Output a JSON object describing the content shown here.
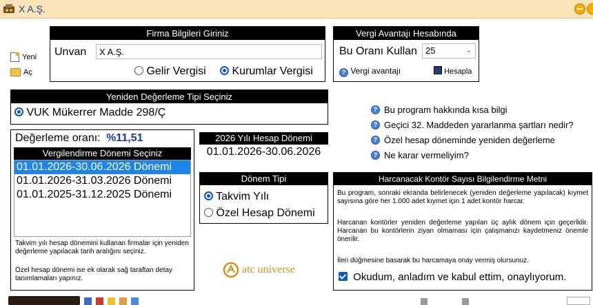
{
  "window": {
    "title": "X A.Ş."
  },
  "side": {
    "new_label": "Yeni",
    "open_label": "Aç"
  },
  "firma": {
    "header": "Firma Bilgileri Giriniz",
    "unvan_label": "Unvan",
    "unvan_value": "X A.Ş.",
    "radio_gelir": "Gelir Vergisi",
    "radio_kurumlar": "Kurumlar Vergisi",
    "selected": "kurumlar"
  },
  "vergi": {
    "header": "Vergi Avantajı Hesabında",
    "oran_label": "Bu Oranı Kullan",
    "oran_value": "25",
    "avantaj_label": "Vergi avantajı",
    "hesapla_label": "Hesapla"
  },
  "yeniden": {
    "header": "Yeniden Değerleme Tipi Seçiniz",
    "option": "VUK Mükerrer Madde 298/Ç"
  },
  "questions": [
    "Bu program hakkında kısa bilgi",
    "Geçici 32. Maddeden yararlanma şartları nedir?",
    "Özel hesap döneminde yeniden değerleme",
    "Ne karar vermeliyim?"
  ],
  "degerleme": {
    "oran_label": "Değerleme oranı:",
    "oran_value": "%11,51",
    "list_header": "Vergilendirme Dönemi Seçiniz",
    "items": [
      "01.01.2026-30.06.2026 Dönemi",
      "01.01.2026-31.03.2026 Dönemi",
      "01.01.2025-31.12.2025 Dönemi"
    ],
    "selected_index": 0,
    "note1": "Takvim yılı hesap dönemini kullanan firmalar için yeniden değerleme yapılacak tarih aralığını seçiniz.",
    "note2": "Özel hesap dönemi ise ek olarak sağ taraftan detay tanımlamaları yapınız."
  },
  "hesap": {
    "header": "2026 Yılı Hesap Dönemi",
    "value": "01.01.2026-30.06.2026"
  },
  "donem": {
    "header": "Dönem Tipi",
    "opt1": "Takvim Yılı",
    "opt2": "Özel Hesap Dönemi",
    "selected": "takvim"
  },
  "logo": {
    "text": "atc universe"
  },
  "kontor": {
    "header": "Harcanacak Kontör Sayısı Bilgilendirme Metni",
    "p1": "Bu program, sonraki ekranda belirlenecek (yeniden değerleme yapılacak) kıymet sayısına göre her 1.000 adet kıymet için 1 adet kontör harcar.",
    "p2": "Harcanan kontörler yeniden değerleme yapılan üç aylık dönem için geçerlidir. Harcanan bu kontörlerin ziyan olmaması için çalışmanızı kaydetmeniz önemle önerilir.",
    "p3": "İleri düğmesine basarak bu harcamaya onay vermiş olursunuz.",
    "consent": "Okudum, anladım ve kabul ettim, onaylıyorum.",
    "checked": true
  },
  "colors": {
    "accent": "#0a55c9",
    "selection": "#1f86e8",
    "titlebar": "#f9e3b7",
    "logo": "#c8961e"
  }
}
